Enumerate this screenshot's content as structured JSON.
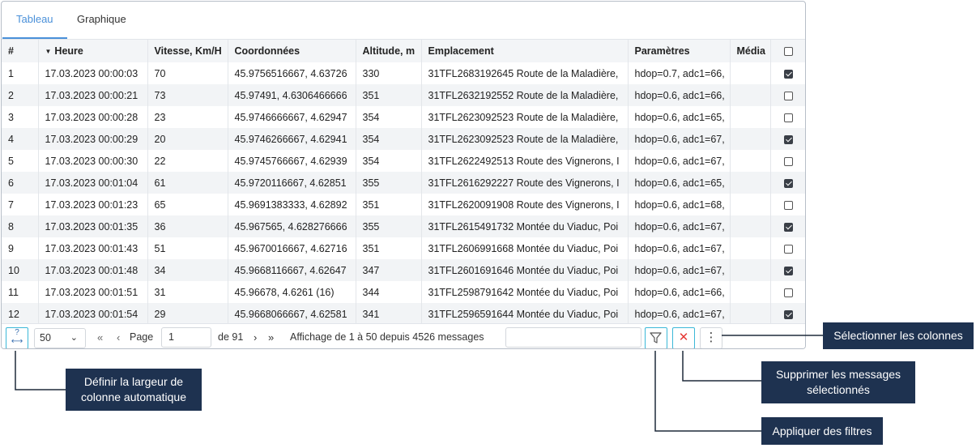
{
  "tabs": [
    {
      "label": "Tableau",
      "active": true
    },
    {
      "label": "Graphique",
      "active": false
    }
  ],
  "columns": [
    "#",
    "Heure",
    "Vitesse, Km/H",
    "Coordonnées",
    "Altitude, m",
    "Emplacement",
    "Paramètres",
    "Média"
  ],
  "sorted_column": "Heure",
  "rows": [
    {
      "n": "1",
      "time": "17.03.2023 00:00:03",
      "speed": "70",
      "coords": "45.9756516667, 4.63726",
      "alt": "330",
      "loc": "31TFL2683192645 Route de la Maladière,",
      "params": "hdop=0.7, adc1=66,",
      "checked": true
    },
    {
      "n": "2",
      "time": "17.03.2023 00:00:21",
      "speed": "73",
      "coords": "45.97491, 4.6306466666",
      "alt": "351",
      "loc": "31TFL2632192552 Route de la Maladière,",
      "params": "hdop=0.6, adc1=66,",
      "checked": false
    },
    {
      "n": "3",
      "time": "17.03.2023 00:00:28",
      "speed": "23",
      "coords": "45.9746666667, 4.62947",
      "alt": "354",
      "loc": "31TFL2623092523 Route de la Maladière,",
      "params": "hdop=0.6, adc1=65,",
      "checked": false
    },
    {
      "n": "4",
      "time": "17.03.2023 00:00:29",
      "speed": "20",
      "coords": "45.9746266667, 4.62941",
      "alt": "354",
      "loc": "31TFL2623092523 Route de la Maladière,",
      "params": "hdop=0.6, adc1=67,",
      "checked": true
    },
    {
      "n": "5",
      "time": "17.03.2023 00:00:30",
      "speed": "22",
      "coords": "45.9745766667, 4.62939",
      "alt": "354",
      "loc": "31TFL2622492513 Route des Vignerons, I",
      "params": "hdop=0.6, adc1=67,",
      "checked": false
    },
    {
      "n": "6",
      "time": "17.03.2023 00:01:04",
      "speed": "61",
      "coords": "45.9720116667, 4.62851",
      "alt": "355",
      "loc": "31TFL2616292227 Route des Vignerons, I",
      "params": "hdop=0.6, adc1=65,",
      "checked": true
    },
    {
      "n": "7",
      "time": "17.03.2023 00:01:23",
      "speed": "65",
      "coords": "45.9691383333, 4.62892",
      "alt": "351",
      "loc": "31TFL2620091908 Route des Vignerons, I",
      "params": "hdop=0.6, adc1=68,",
      "checked": false
    },
    {
      "n": "8",
      "time": "17.03.2023 00:01:35",
      "speed": "36",
      "coords": "45.967565, 4.628276666",
      "alt": "355",
      "loc": "31TFL2615491732 Montée du Viaduc, Poi",
      "params": "hdop=0.6, adc1=67,",
      "checked": true
    },
    {
      "n": "9",
      "time": "17.03.2023 00:01:43",
      "speed": "51",
      "coords": "45.9670016667, 4.62716",
      "alt": "351",
      "loc": "31TFL2606991668 Montée du Viaduc, Poi",
      "params": "hdop=0.6, adc1=67,",
      "checked": false
    },
    {
      "n": "10",
      "time": "17.03.2023 00:01:48",
      "speed": "34",
      "coords": "45.9668116667, 4.62647",
      "alt": "347",
      "loc": "31TFL2601691646 Montée du Viaduc, Poi",
      "params": "hdop=0.6, adc1=67,",
      "checked": true
    },
    {
      "n": "11",
      "time": "17.03.2023 00:01:51",
      "speed": "31",
      "coords": "45.96678, 4.6261 (16)",
      "alt": "344",
      "loc": "31TFL2598791642 Montée du Viaduc, Poi",
      "params": "hdop=0.6, adc1=66,",
      "checked": false
    },
    {
      "n": "12",
      "time": "17.03.2023 00:01:54",
      "speed": "29",
      "coords": "45.9668066667, 4.62581",
      "alt": "341",
      "loc": "31TFL2596591644 Montée du Viaduc, Poi",
      "params": "hdop=0.6, adc1=67,",
      "checked": true
    }
  ],
  "footer": {
    "autowidth_icon": "auto-column-width-icon",
    "page_size": "50",
    "page_label": "Page",
    "page_value": "1",
    "of_pages": "de 91",
    "summary": "Affichage de 1 à 50 depuis 4526 messages",
    "filter_placeholder": "",
    "first": "«",
    "prev": "‹",
    "next": "›",
    "last": "»",
    "delete_symbol": "✕",
    "columns_symbol": "⋮"
  },
  "callouts": {
    "select_columns": "Sélectionner les colonnes",
    "auto_width_line1": "Définir la largeur de",
    "auto_width_line2": "colonne automatique",
    "delete_line1": "Supprimer les messages",
    "delete_line2": "sélectionnés",
    "filters": "Appliquer des filtres"
  },
  "colors": {
    "accent": "#4a90d9",
    "highlight": "#3bb8d8",
    "callout_bg": "#1e3250",
    "delete": "#e53935"
  }
}
